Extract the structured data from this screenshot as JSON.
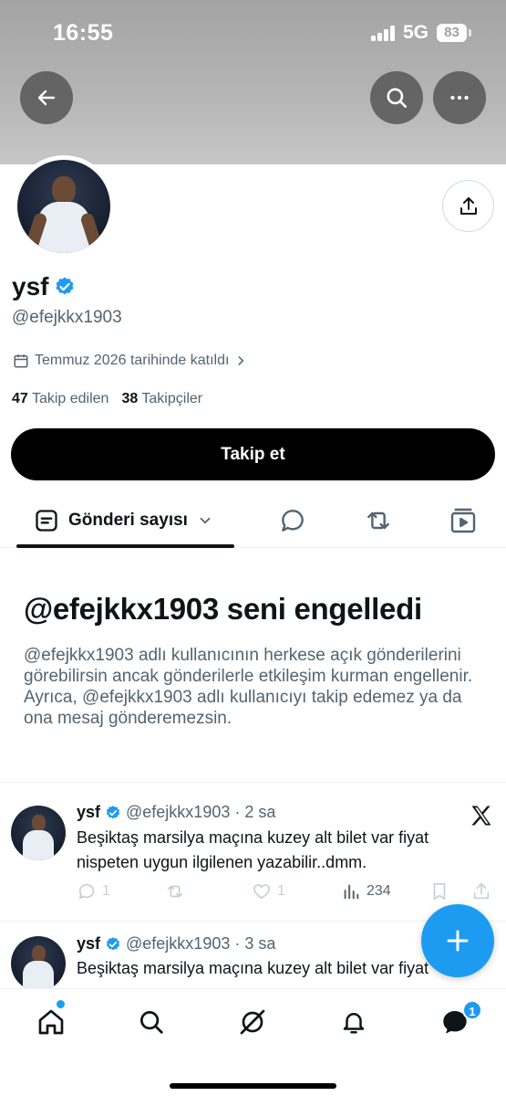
{
  "status_bar": {
    "time": "16:55",
    "network": "5G",
    "battery": "83"
  },
  "profile": {
    "name": "ysf",
    "handle": "@efejkkx1903",
    "joined": "Temmuz 2026 tarihinde katıldı",
    "following_count": "47",
    "following_label": "Takip edilen",
    "followers_count": "38",
    "followers_label": "Takipçiler",
    "follow_button": "Takip et"
  },
  "tabs": {
    "active_label": "Gönderi sayısı"
  },
  "blocked": {
    "title": "@efejkkx1903 seni engelledi",
    "text": "@efejkkx1903 adlı kullanıcının herkese açık gönderilerini görebilirsin ancak gönderilerle etkileşim kurman engellenir. Ayrıca, @efejkkx1903 adlı kullanıcıyı takip edemez ya da ona mesaj gönderemezsin."
  },
  "tweets": [
    {
      "name": "ysf",
      "handle": "@efejkkx1903",
      "time": "· 2 sa",
      "text": "Beşiktaş marsilya maçına kuzey alt bilet var fiyat nispeten uygun ilgilenen yazabilir..dmm.",
      "replies": "1",
      "likes": "1",
      "views": "234"
    },
    {
      "name": "ysf",
      "handle": "@efejkkx1903",
      "time": "· 3 sa",
      "text": "Beşiktaş marsilya maçına kuzey alt bilet var fiyat"
    }
  ],
  "nav": {
    "messages_badge": "1"
  },
  "colors": {
    "accent": "#1d9bf0",
    "text": "#0f1419",
    "muted": "#536471"
  }
}
